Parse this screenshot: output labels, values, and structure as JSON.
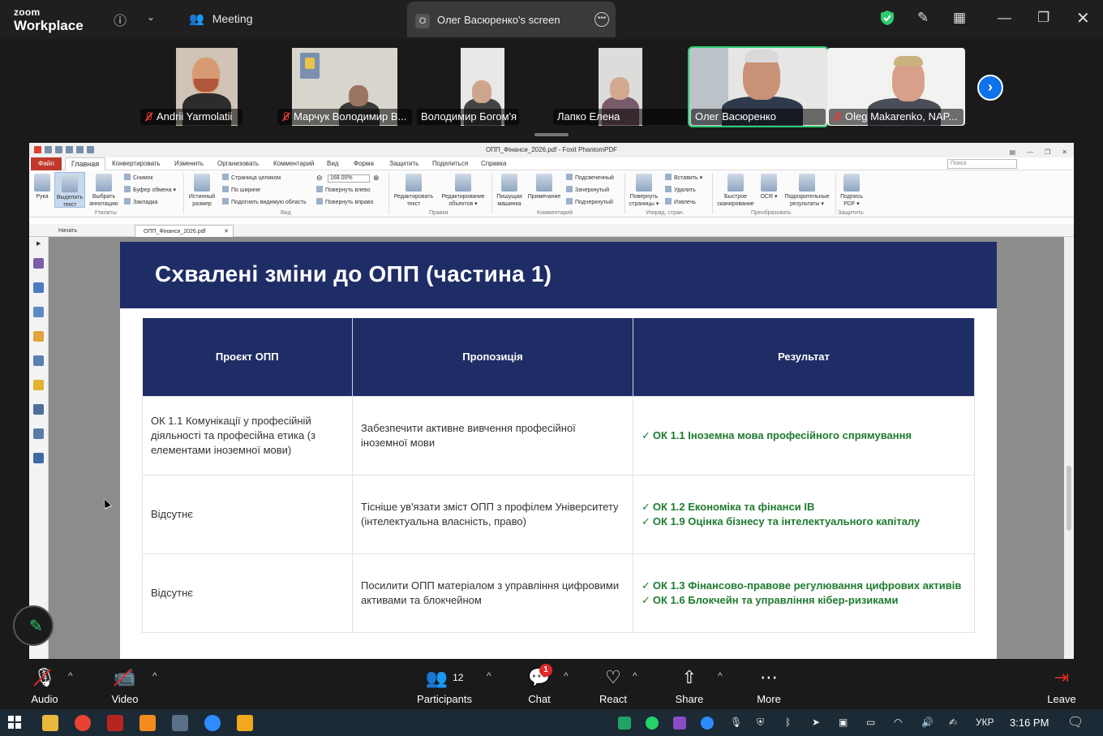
{
  "app": {
    "logo_top": "zoom",
    "logo_bottom": "Workplace"
  },
  "topbar": {
    "meeting_label": "Meeting",
    "screen_tab_badge": "O",
    "screen_tab_title": "Олег Васюренко's screen",
    "icons": [
      "info-icon",
      "chevron-down-icon",
      "participants-icon",
      "more-icon",
      "shield-icon",
      "pencil-icon",
      "grid-icon",
      "minimize-icon",
      "restore-icon",
      "close-icon"
    ]
  },
  "participants_strip": [
    {
      "name": "Andrii Yarmolatii",
      "muted": true
    },
    {
      "name": "Марчук Володимир В...",
      "muted": true
    },
    {
      "name": "Володимир Богом'я",
      "muted": false
    },
    {
      "name": "Лапко Елена",
      "muted": false
    },
    {
      "name": "Олег Васюренко",
      "muted": false,
      "active": true
    },
    {
      "name": "Oleg Makarenko, NAP...",
      "muted": true
    }
  ],
  "foxit": {
    "window_title": "ОПП_Фінанси_2026.pdf - Foxit PhantomPDF",
    "menu": [
      "Файл",
      "Главная",
      "Конвертировать",
      "Изменить",
      "Организовать",
      "Комментарий",
      "Вид",
      "Форма",
      "Защитить",
      "Поделиться",
      "Справка"
    ],
    "search_placeholder": "Поиск",
    "ribbon": {
      "hand": "Рука",
      "select_text": "Выделить текст",
      "select_annot": "Выбрать аннотацию",
      "snapshot": "Снимок",
      "clipboard": "Буфер обмена",
      "bookmark": "Закладка",
      "group_utilities": "Утилиты",
      "actual_size": "Истинный размер",
      "fit_page": "Страница целиком",
      "fit_width": "По ширине",
      "fit_visible": "Подогнать видимую область",
      "zoom_value": "168.00%",
      "rotate_left": "Повернуть влево",
      "rotate_right": "Повернуть вправо",
      "group_view": "Вид",
      "edit_text": "Редактировать текст",
      "edit_objects": "Редактирование объектов",
      "group_edit": "Правка",
      "typewriter": "Пишущая машинка",
      "note": "Примечание",
      "highlight": "Подсвеченный",
      "strikeout": "Зачеркнутый",
      "underline": "Подчеркнутый",
      "group_comment": "Комментарий",
      "rotate_pages": "Повернуть страницы",
      "insert": "Вставить",
      "delete": "Удалить",
      "extract": "Извлечь",
      "group_pages": "Упоряд. стран.",
      "quick_scan": "Быстрое сканирование",
      "ocr": "OCR",
      "suspect": "Подозрительные результаты",
      "group_convert": "Преобразовать",
      "sign": "Подпись PDF",
      "group_protect": "Защитить"
    },
    "doc_tabs": [
      "Начать",
      "ОПП_Фінанси_2026.pdf"
    ]
  },
  "slide": {
    "title": "Схвалені зміни до ОПП (частина 1)",
    "columns": [
      "Проєкт ОПП",
      "Пропозиція",
      "Результат"
    ],
    "rows": [
      {
        "project": "ОК 1.1 Комунікації у професійній діяльності та професійна етика (з елементами іноземної мови)",
        "proposal": "Забезпечити активне вивчення професійної іноземної мови",
        "results": [
          "ОК 1.1 Іноземна мова професійного спрямування"
        ]
      },
      {
        "project": "Відсутнє",
        "proposal": "Тісніше ув'язати зміст ОПП з профілем Університету (інтелектуальна власність, право)",
        "results": [
          "ОК 1.2 Економіка та фінанси ІВ",
          "ОК 1.9 Оцінка бізнесу та інтелектуального капіталу"
        ]
      },
      {
        "project": "Відсутнє",
        "proposal": "Посилити ОПП матеріалом з управління цифровими активами та блокчейном",
        "results": [
          "ОК 1.3 Фінансово-правове регулювання цифрових активів",
          "ОК 1.6 Блокчейн та управління кібер-ризиками"
        ]
      }
    ],
    "check_mark": "✓"
  },
  "controls": {
    "audio": "Audio",
    "video": "Video",
    "participants": "Participants",
    "participants_count": "12",
    "chat": "Chat",
    "chat_badge": "1",
    "react": "React",
    "share": "Share",
    "more": "More",
    "leave": "Leave"
  },
  "taskbar": {
    "language": "УКР",
    "time": "3:16 PM"
  },
  "colors": {
    "slide_navy": "#1f2d66",
    "result_green": "#1e7b2f",
    "active_speaker": "#2ecc71",
    "zoom_blue": "#0e72ed"
  }
}
